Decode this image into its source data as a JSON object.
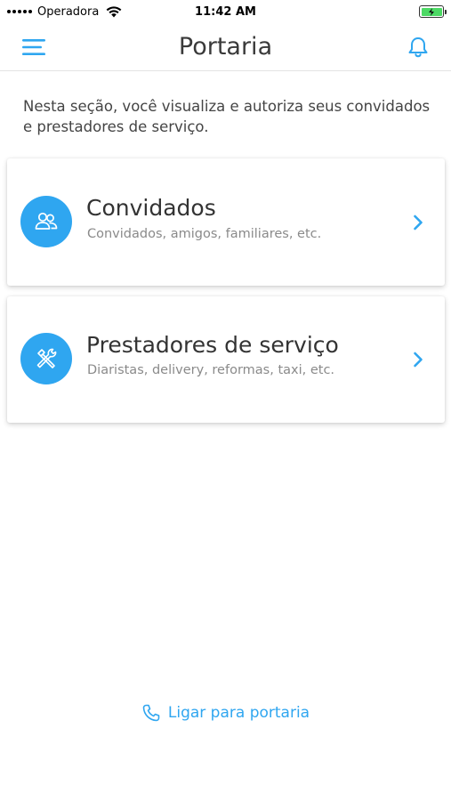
{
  "status_bar": {
    "carrier": "Operadora",
    "time": "11:42 AM"
  },
  "nav": {
    "title": "Portaria",
    "menu_icon": "hamburger-menu-icon",
    "notifications_icon": "bell-icon"
  },
  "intro": {
    "text": "Nesta seção, você visualiza e autoriza seus convidados e prestadores de serviço."
  },
  "cards": [
    {
      "title": "Convidados",
      "subtitle": "Convidados, amigos, familiares, etc.",
      "icon": "people-icon"
    },
    {
      "title": "Prestadores de serviço",
      "subtitle": "Diaristas, delivery, reformas, taxi, etc.",
      "icon": "tools-icon"
    }
  ],
  "call_link": {
    "label": "Ligar para portaria",
    "icon": "phone-icon"
  },
  "colors": {
    "accent": "#2fa6f0",
    "battery": "#4cd964"
  }
}
